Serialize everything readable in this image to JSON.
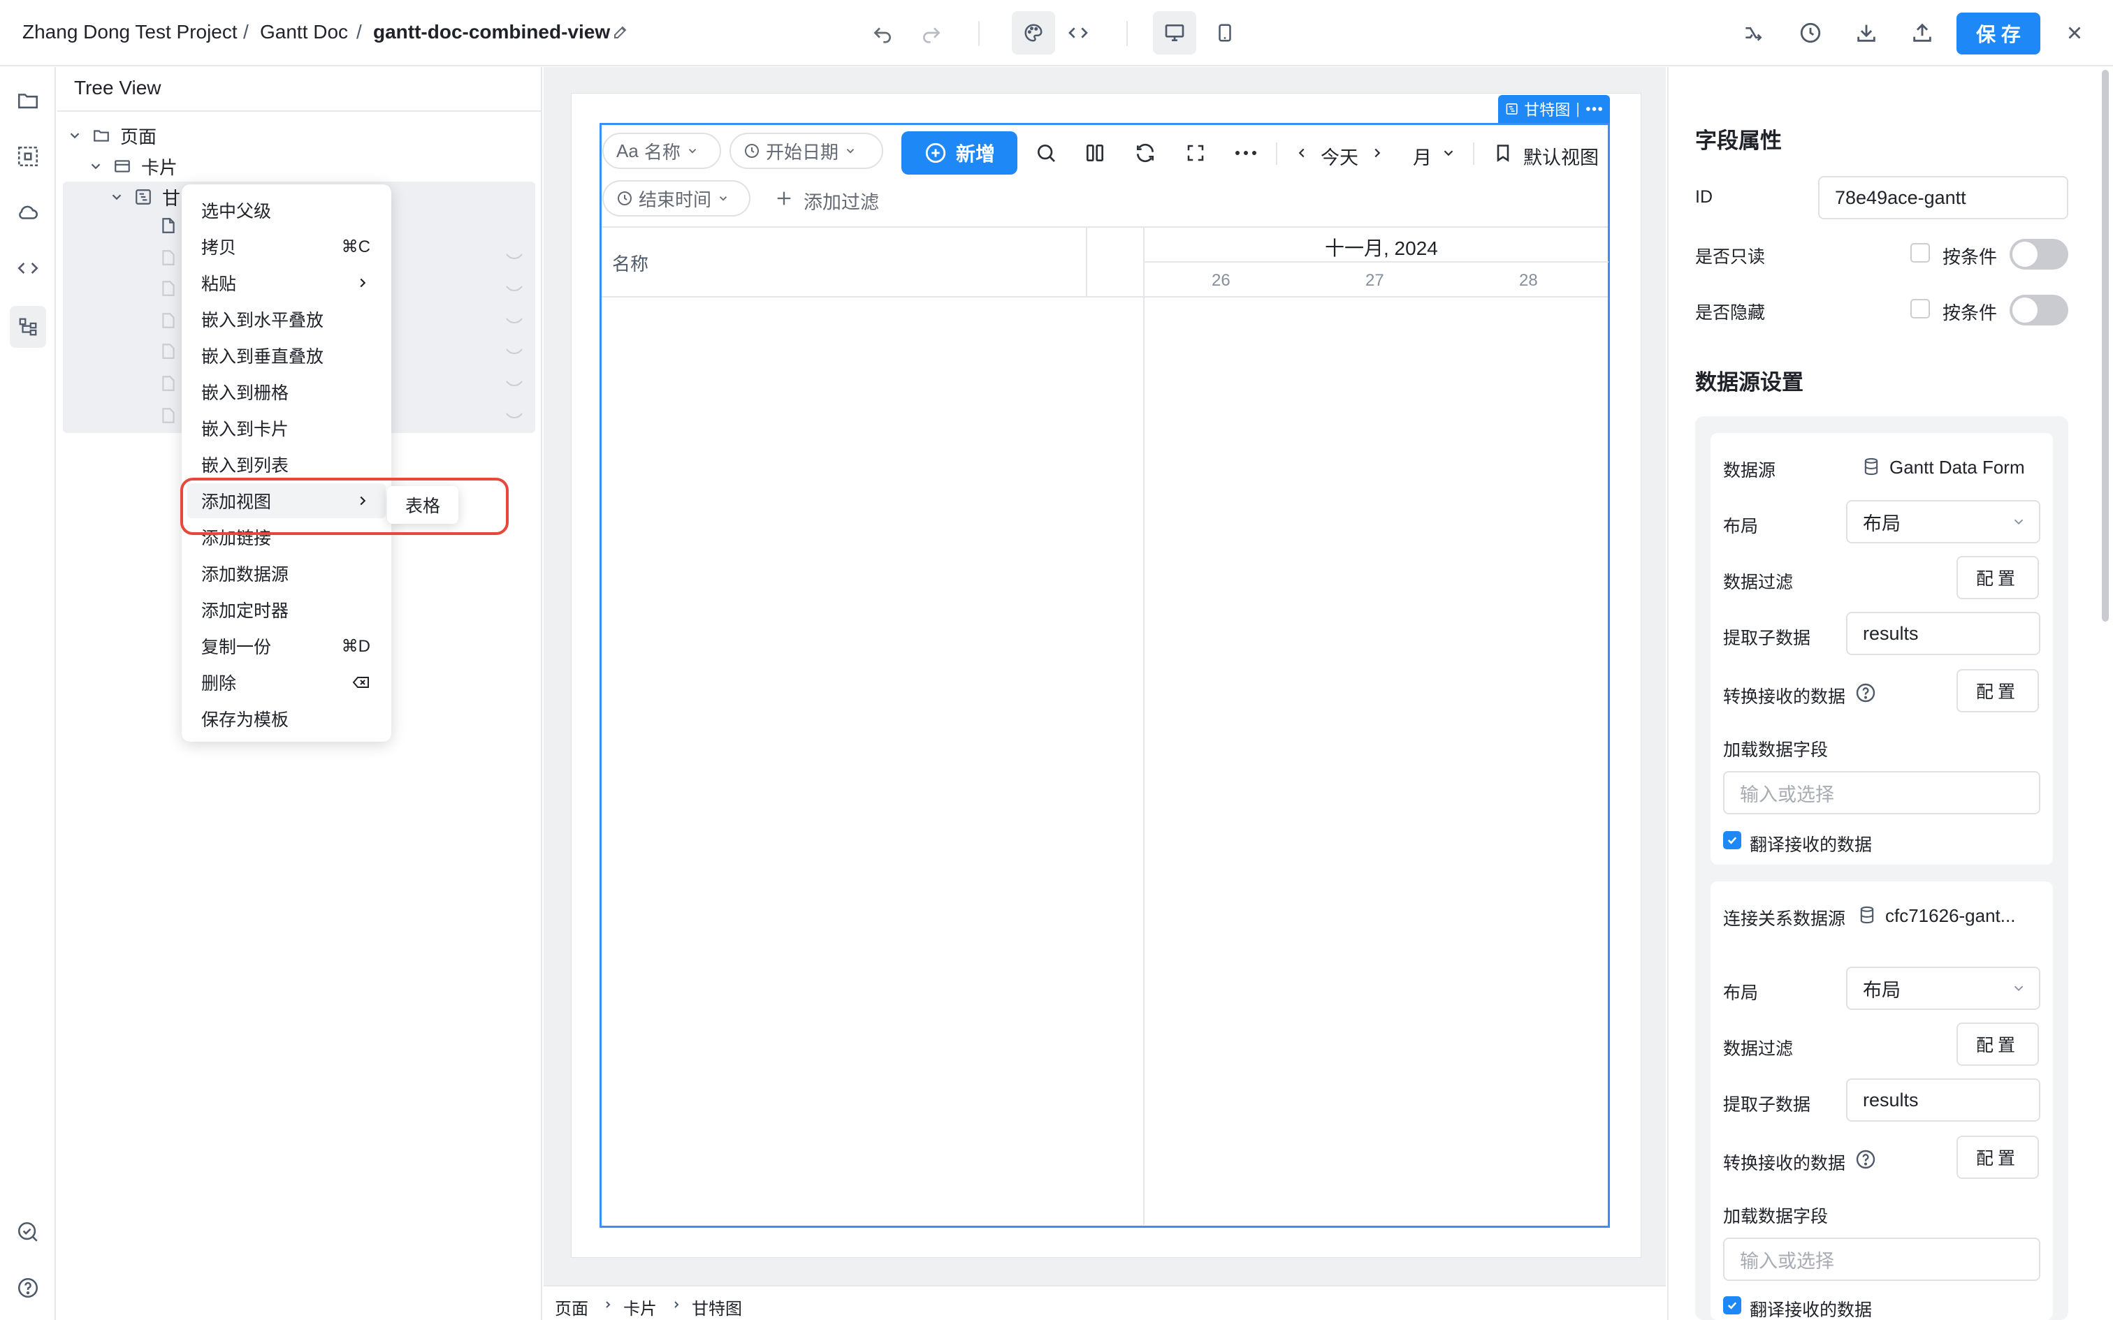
{
  "topbar": {
    "breadcrumb": [
      "Zhang Dong Test Project",
      "Gantt Doc",
      "gantt-doc-combined-view"
    ],
    "separator": "/",
    "save_label": "保 存"
  },
  "tree": {
    "title": "Tree View",
    "root_label": "页面",
    "card_label": "卡片",
    "gantt_label_partial": "甘"
  },
  "context_menu": {
    "items": [
      {
        "label": "选中父级",
        "shortcut": ""
      },
      {
        "label": "拷贝",
        "shortcut": "⌘C"
      },
      {
        "label": "粘贴",
        "shortcut": ""
      },
      {
        "label": "嵌入到水平叠放",
        "shortcut": ""
      },
      {
        "label": "嵌入到垂直叠放",
        "shortcut": ""
      },
      {
        "label": "嵌入到栅格",
        "shortcut": ""
      },
      {
        "label": "嵌入到卡片",
        "shortcut": ""
      },
      {
        "label": "嵌入到列表",
        "shortcut": ""
      },
      {
        "label": "添加视图",
        "shortcut": ""
      },
      {
        "label": "添加链接",
        "shortcut": ""
      },
      {
        "label": "添加数据源",
        "shortcut": ""
      },
      {
        "label": "添加定时器",
        "shortcut": ""
      },
      {
        "label": "复制一份",
        "shortcut": "⌘D"
      },
      {
        "label": "删除",
        "shortcut": ""
      },
      {
        "label": "保存为模板",
        "shortcut": ""
      }
    ],
    "submenu_item": "表格"
  },
  "gantt": {
    "tag_label": "甘特图",
    "filter_name": "名称",
    "filter_name_prefix": "Aa",
    "filter_start": "开始日期",
    "filter_end": "结束时间",
    "add_label": "新增",
    "today_label": "今天",
    "period_label": "月",
    "default_view_label": "默认视图",
    "add_filter_label": "添加过滤",
    "column_name": "名称",
    "month_header": "十一月, 2024",
    "days": [
      "26",
      "27",
      "28"
    ]
  },
  "bottom_breadcrumb": [
    "页面",
    "卡片",
    "甘特图"
  ],
  "props": {
    "section_field": "字段属性",
    "id_label": "ID",
    "id_value": "78e49ace-gantt",
    "readonly_label": "是否只读",
    "hidden_label": "是否隐藏",
    "by_condition": "按条件",
    "section_datasource": "数据源设置",
    "card1": {
      "source_label": "数据源",
      "source_value": "Gantt Data Form",
      "layout_label": "布局",
      "layout_value": "布局",
      "filter_label": "数据过滤",
      "config_label": "配置",
      "extract_label": "提取子数据",
      "extract_value": "results",
      "transform_label": "转换接收的数据",
      "load_fields_label": "加载数据字段",
      "load_fields_placeholder": "输入或选择",
      "translate_label": "翻译接收的数据"
    },
    "card2": {
      "source_label": "连接关系数据源",
      "source_value": "cfc71626-gant...",
      "layout_label": "布局",
      "layout_value": "布局",
      "filter_label": "数据过滤",
      "config_label": "配置",
      "extract_label": "提取子数据",
      "extract_value": "results",
      "transform_label": "转换接收的数据",
      "load_fields_label": "加载数据字段",
      "load_fields_placeholder": "输入或选择",
      "translate_label": "翻译接收的数据"
    }
  }
}
